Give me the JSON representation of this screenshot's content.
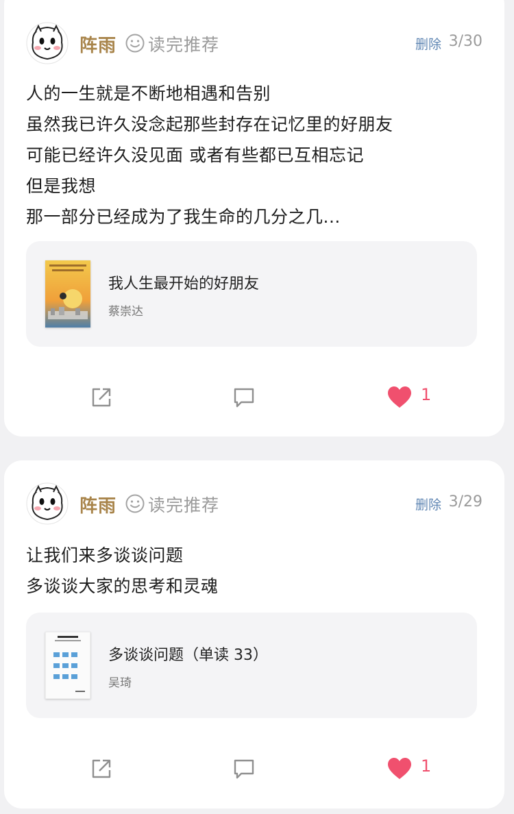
{
  "posts": [
    {
      "username": "阵雨",
      "badge": "读完推荐",
      "delete_label": "删除",
      "date": "3/30",
      "lines": [
        "人的一生就是不断地相遇和告别",
        "虽然我已许久没念起那些封存在记忆里的好朋友",
        "可能已经许久没见面 或者有些都已互相忘记",
        "但是我想",
        "那一部分已经成为了我生命的几分之几..."
      ],
      "book": {
        "title": "我人生最开始的好朋友",
        "author": "蔡崇达"
      },
      "likes": "1"
    },
    {
      "username": "阵雨",
      "badge": "读完推荐",
      "delete_label": "删除",
      "date": "3/29",
      "lines": [
        "让我们来多谈谈问题",
        "多谈谈大家的思考和灵魂"
      ],
      "book": {
        "title": "多谈谈问题（单读 33）",
        "author": "吴琦"
      },
      "likes": "1"
    }
  ],
  "colors": {
    "username": "#a8844a",
    "delete": "#5f86b3",
    "like": "#f0506e",
    "card_bg": "#ffffff",
    "page_bg": "#f1f1f3"
  },
  "icons": {
    "badge": "smile-icon",
    "share": "share-icon",
    "comment": "comment-icon",
    "like": "heart-icon"
  }
}
